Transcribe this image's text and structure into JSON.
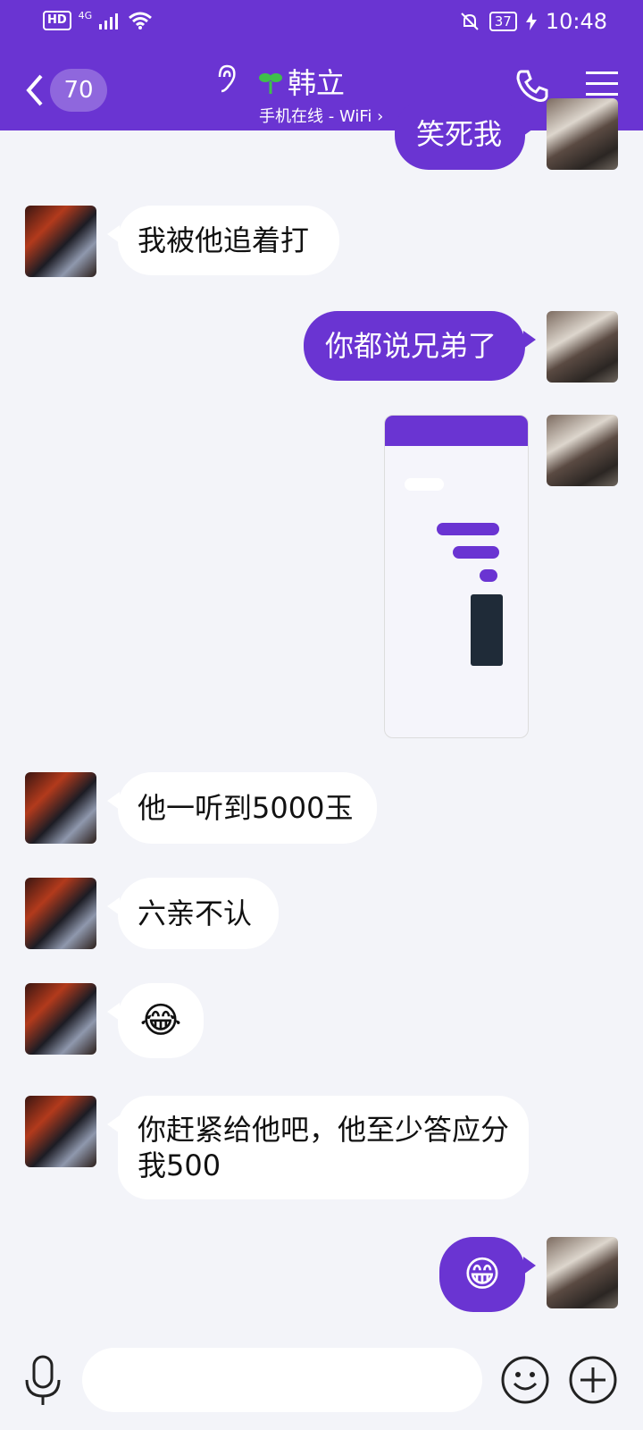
{
  "status_bar": {
    "hd": "HD",
    "network": "4G",
    "battery": "37",
    "time": "10:48"
  },
  "header": {
    "unread_count": "70",
    "title": "韩立",
    "subtitle": "手机在线 - WiFi"
  },
  "messages": [
    {
      "side": "out",
      "text": "笑死我"
    },
    {
      "side": "in",
      "text": "我被他追着打"
    },
    {
      "side": "out",
      "text": "你都说兄弟了"
    },
    {
      "side": "out",
      "type": "image",
      "text": ""
    },
    {
      "side": "in",
      "text": "他一听到5000玉"
    },
    {
      "side": "in",
      "text": "六亲不认"
    },
    {
      "side": "in",
      "type": "emoji",
      "text": "😂"
    },
    {
      "side": "in",
      "text": "你赶紧给他吧，他至少答应分我500"
    },
    {
      "side": "out",
      "type": "emoji",
      "text": "😁"
    }
  ],
  "input": {
    "placeholder": ""
  },
  "colors": {
    "primary": "#6a34d2",
    "background": "#f3f4f9",
    "bubble_in": "#ffffff"
  },
  "icons": [
    "back-chevron-icon",
    "ear-icon",
    "sprout-icon",
    "phone-icon",
    "menu-icon",
    "microphone-icon",
    "emoji-icon",
    "plus-icon"
  ]
}
